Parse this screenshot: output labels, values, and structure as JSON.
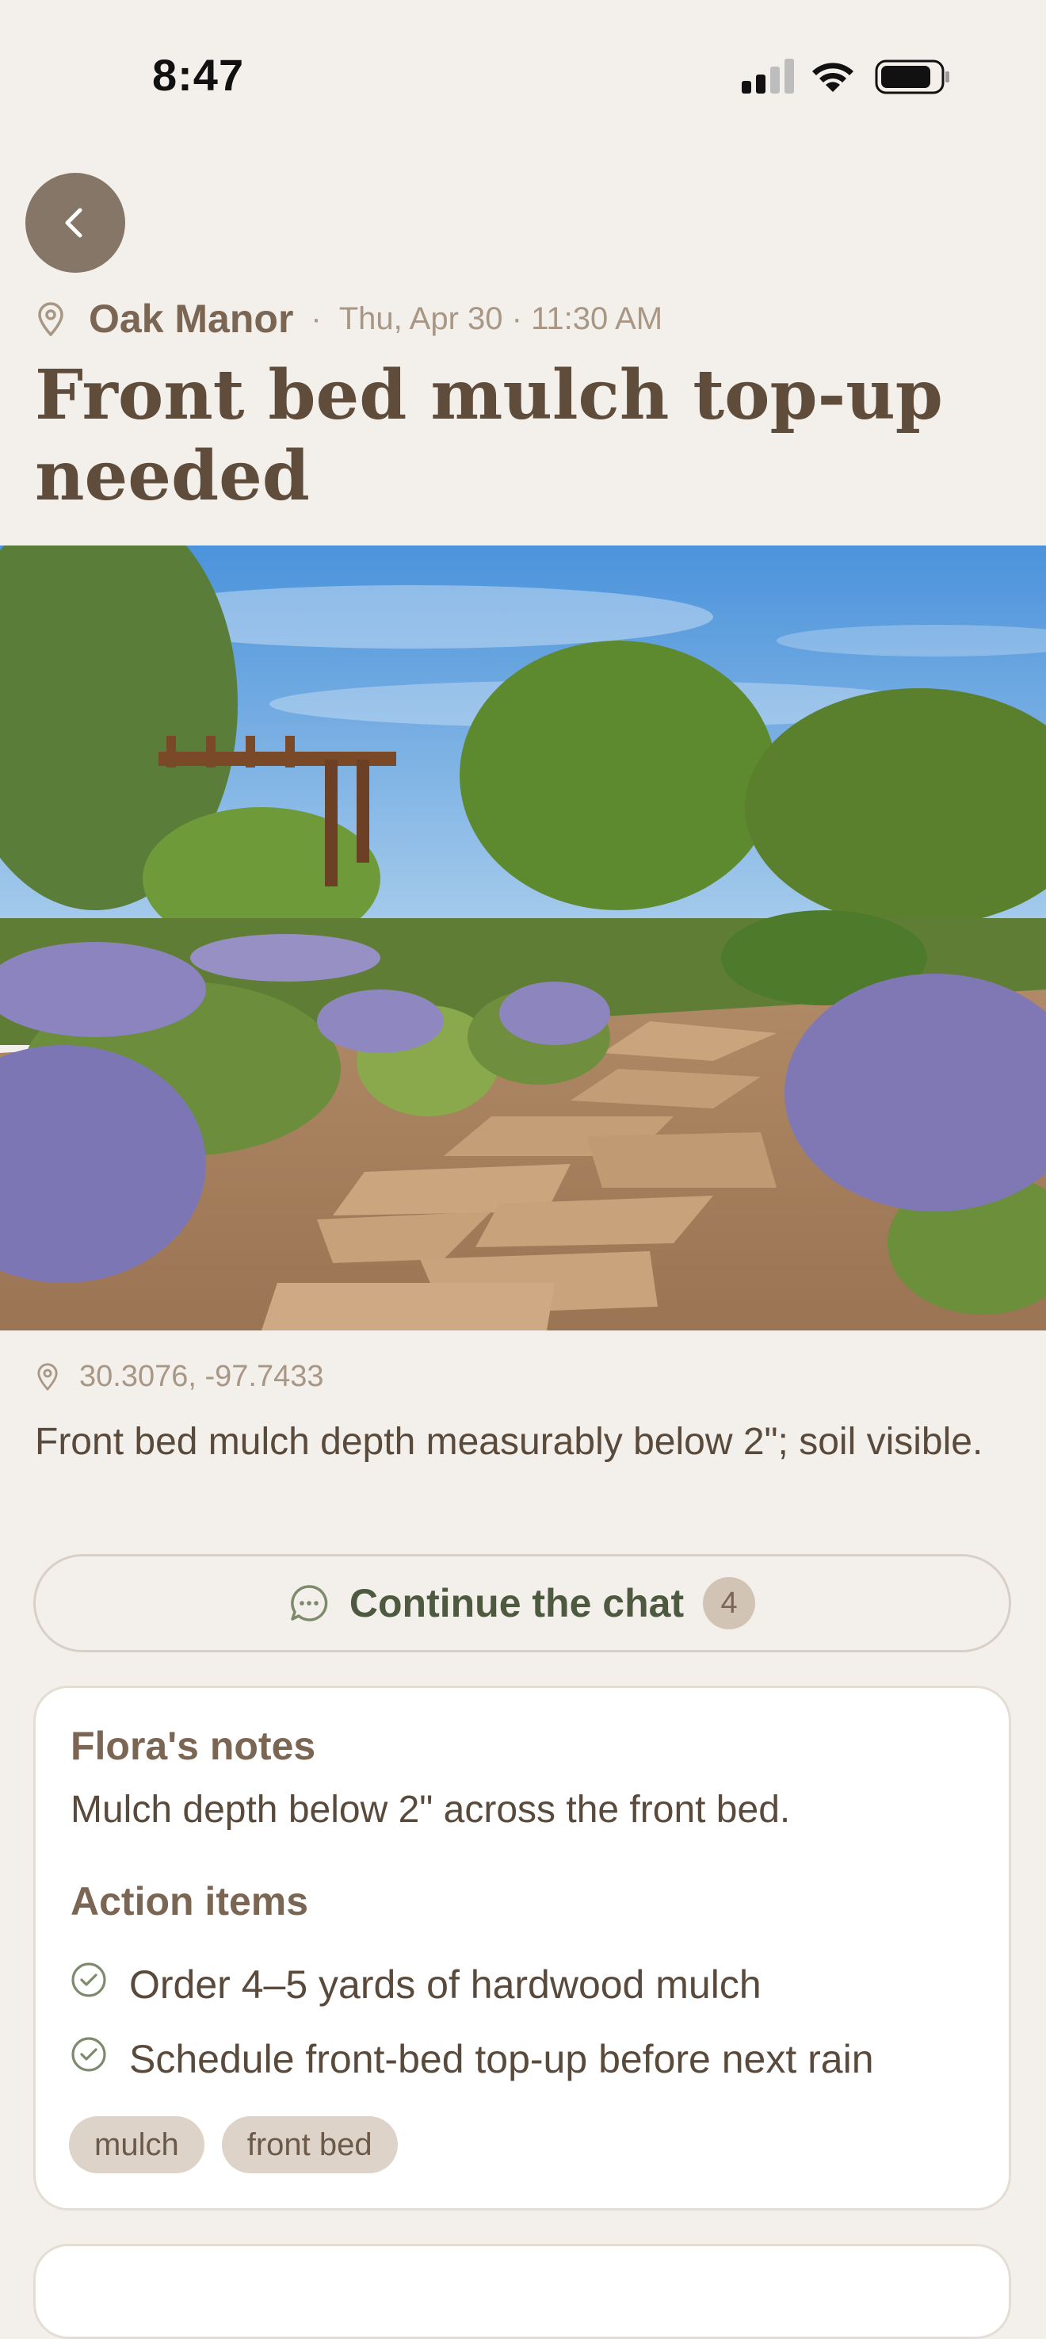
{
  "status_bar": {
    "time": "8:47"
  },
  "header": {
    "property": "Oak Manor",
    "separator": "·",
    "datetime": "Thu, Apr 30 · 11:30 AM",
    "title": "Front bed mulch top-up needed"
  },
  "photo": {
    "subject": "landscaped garden"
  },
  "location": {
    "coordinates": "30.3076, -97.7433"
  },
  "description": "Front bed mulch depth measurably below 2\"; soil visible.",
  "chat": {
    "label": "Continue the chat",
    "count": "4"
  },
  "notes": {
    "heading": "Flora's notes",
    "body": "Mulch depth below 2\" across the front bed.",
    "actions_heading": "Action items",
    "actions": [
      "Order 4–5 yards of hardwood mulch",
      "Schedule front-bed top-up before next rain"
    ],
    "tags": [
      "mulch",
      "front bed"
    ]
  },
  "colors": {
    "background": "#f3f0eb",
    "accent_brown": "#7b6654",
    "chat_green": "#4e5a3f",
    "back_button": "#857667"
  }
}
